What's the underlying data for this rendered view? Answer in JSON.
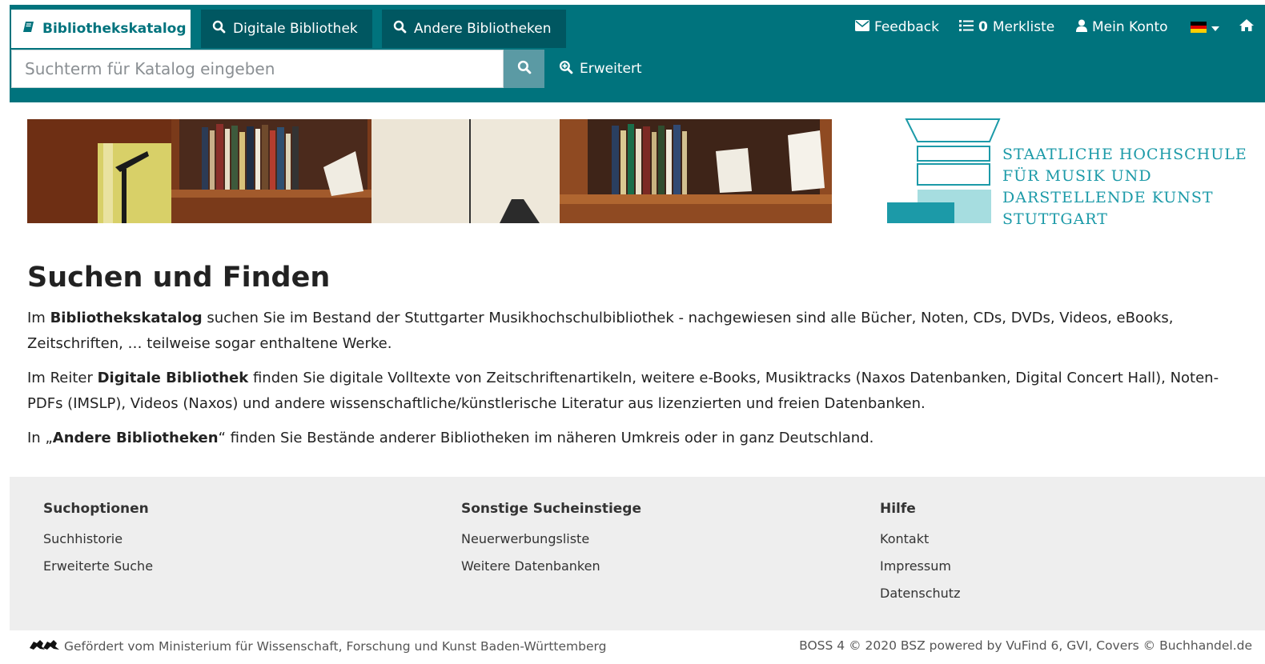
{
  "colors": {
    "header": "#00737d",
    "tab_inactive": "#005761",
    "search_button": "#5b9aa4",
    "footer": "#eeeeee",
    "logo": "#1c9aa8"
  },
  "tabs": [
    {
      "label": "Bibliothekskatalog",
      "icon": "book-icon",
      "active": true
    },
    {
      "label": "Digitale Bibliothek",
      "icon": "search-icon",
      "active": false
    },
    {
      "label": "Andere Bibliotheken",
      "icon": "search-icon",
      "active": false
    }
  ],
  "search": {
    "placeholder": "Suchterm für Katalog eingeben",
    "value": "",
    "advanced_label": "Erweitert"
  },
  "topnav": {
    "feedback": "Feedback",
    "merkliste_count": "0",
    "merkliste": "Merkliste",
    "konto": "Mein Konto",
    "language_icon": "german-flag-icon",
    "home_icon": "home-icon"
  },
  "logo": {
    "lines": [
      "STAATLICHE HOCHSCHULE",
      "FÜR MUSIK UND",
      "DARSTELLENDE KUNST",
      "STUTTGART"
    ]
  },
  "main": {
    "title": "Suchen und Finden",
    "p1": {
      "pre": "Im ",
      "bold": "Bibliothekskatalog",
      "post": " suchen Sie im Bestand der Stuttgarter Musikhochschulbibliothek - nachgewiesen sind alle Bücher, Noten, CDs, DVDs, Videos, eBooks, Zeitschriften, … teilweise sogar enthaltene Werke."
    },
    "p2": {
      "pre": "Im Reiter ",
      "bold": "Digitale Bibliothek",
      "post": " finden Sie digitale Volltexte von Zeitschriftenartikeln, weitere e-Books, Musiktracks (Naxos Datenbanken, Digital Concert Hall), Noten-PDFs (IMSLP), Videos (Naxos) und andere wissenschaftliche/künstlerische Literatur aus lizenzierten und freien Datenbanken."
    },
    "p3": {
      "pre": "In „",
      "bold": "Andere Bibliotheken",
      "post": "“ finden Sie Bestände anderer Bibliotheken im näheren Umkreis oder in ganz Deutschland."
    }
  },
  "footer": {
    "columns": [
      {
        "heading": "Suchoptionen",
        "links": [
          "Suchhistorie",
          "Erweiterte Suche"
        ]
      },
      {
        "heading": "Sonstige Sucheinstiege",
        "links": [
          "Neuerwerbungsliste",
          "Weitere Datenbanken"
        ]
      },
      {
        "heading": "Hilfe",
        "links": [
          "Kontakt",
          "Impressum",
          "Datenschutz"
        ]
      }
    ],
    "funding": "Gefördert vom Ministerium für Wissenschaft, Forschung und Kunst Baden-Württemberg",
    "funding_icon": "bw-lions-icon",
    "credits": "BOSS 4 © 2020 BSZ powered by VuFind 6, GVI, Covers © Buchhandel.de"
  }
}
